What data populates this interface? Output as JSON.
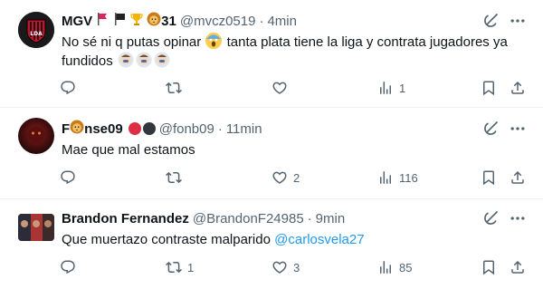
{
  "tweets": [
    {
      "name": "MGV",
      "name_suffix": "31",
      "handle": "@mvcz0519",
      "dot": "·",
      "time": "4min",
      "text_parts": [
        "No sé ni q putas opinar ",
        " tanta plata tiene la liga y contrata jugadores ya fundidos "
      ],
      "replies": "",
      "retweets": "",
      "likes": "",
      "views": "1",
      "avatar_text": "LDA"
    },
    {
      "name_prefix": "F",
      "name_rest": "nse09",
      "handle": "@fonb09",
      "dot": "·",
      "time": "11min",
      "text": "Mae que mal estamos",
      "replies": "",
      "retweets": "",
      "likes": "2",
      "views": "116"
    },
    {
      "name": "Brandon Fernandez",
      "handle": "@BrandonF24985",
      "dot": "·",
      "time": "9min",
      "text": "Que muertazo contraste malparido ",
      "mention": "@carlosvela27",
      "replies": "",
      "retweets": "1",
      "likes": "3",
      "views": "85"
    }
  ],
  "icons": {
    "reply": "reply-icon",
    "retweet": "retweet-icon",
    "like": "heart-icon",
    "views": "views-icon",
    "bookmark": "bookmark-icon",
    "share": "share-icon",
    "grok": "grok-icon",
    "more": "more-icon"
  },
  "colors": {
    "text": "#0f1419",
    "secondary": "#536471",
    "link": "#1d9bf0",
    "divider": "#eff3f4"
  }
}
